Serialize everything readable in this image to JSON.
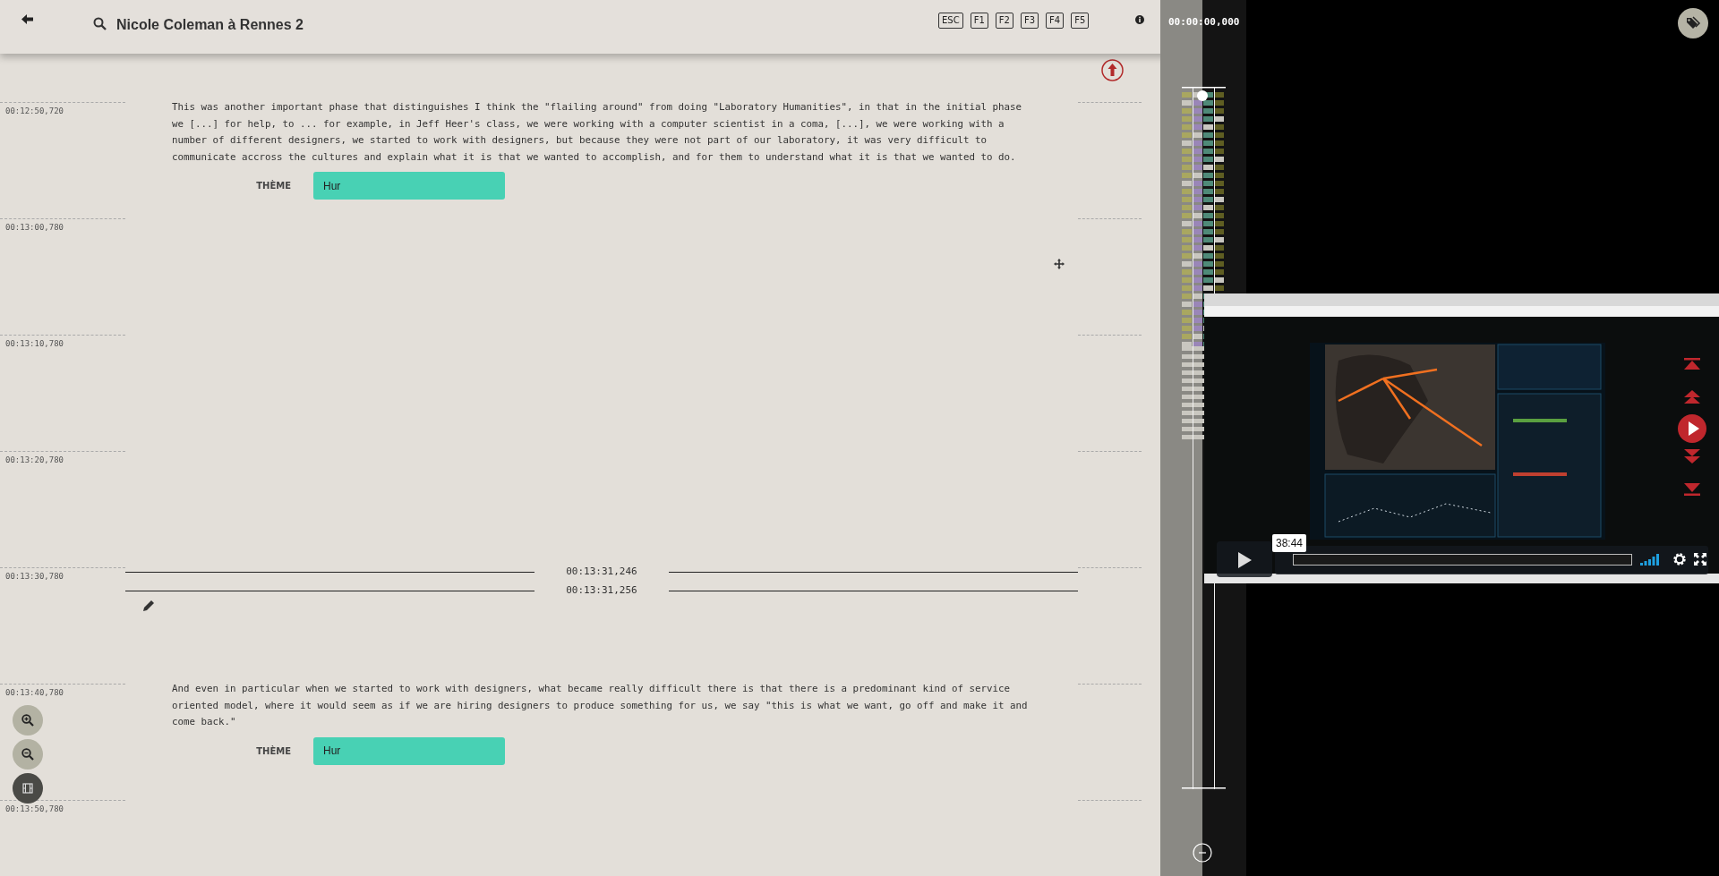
{
  "header": {
    "title": "Nicole Coleman à Rennes 2",
    "keys": [
      "ESC",
      "F1",
      "F2",
      "F3",
      "F4",
      "F5"
    ],
    "timecode": "00:00:00,000"
  },
  "transcript": {
    "rows": [
      {
        "time": "00:12:50,720",
        "kind": "text",
        "text": "This was another important phase that distinguishes I think the \"flailing around\" from doing \"Laboratory Humanities\", in that in the initial phase we [...] for help, to ... for example, in Jeff Heer's class, we were working with a computer scientist in a coma, [...], we were working with a number of different designers, we started to work with designers, but because they were not part of our laboratory, it was very difficult to communicate accross the cultures and explain what it is that we wanted to accomplish, and for them to understand what it is that we wanted to do.",
        "theme_label": "THÈME",
        "theme_value": "Hur"
      },
      {
        "time": "00:13:00,780",
        "kind": "empty"
      },
      {
        "time": "00:13:10,780",
        "kind": "empty"
      },
      {
        "time": "00:13:20,780",
        "kind": "empty"
      },
      {
        "time": "00:13:30,780",
        "kind": "cut",
        "start": "00:13:31,246",
        "end": "00:13:31,256"
      },
      {
        "time": "00:13:40,780",
        "kind": "text",
        "text": "And even in particular when we started to work with designers, what became really difficult there is that there is a predominant kind of service oriented model, where it would seem as if we are hiring designers to produce something for us, we say \"this is what we want, go off and make it and come back.\"",
        "theme_label": "THÈME",
        "theme_value": "Hur"
      },
      {
        "time": "00:13:50,780",
        "kind": "empty"
      }
    ]
  },
  "video": {
    "time_tooltip": "38:44",
    "progress": {
      "level": 0
    }
  }
}
